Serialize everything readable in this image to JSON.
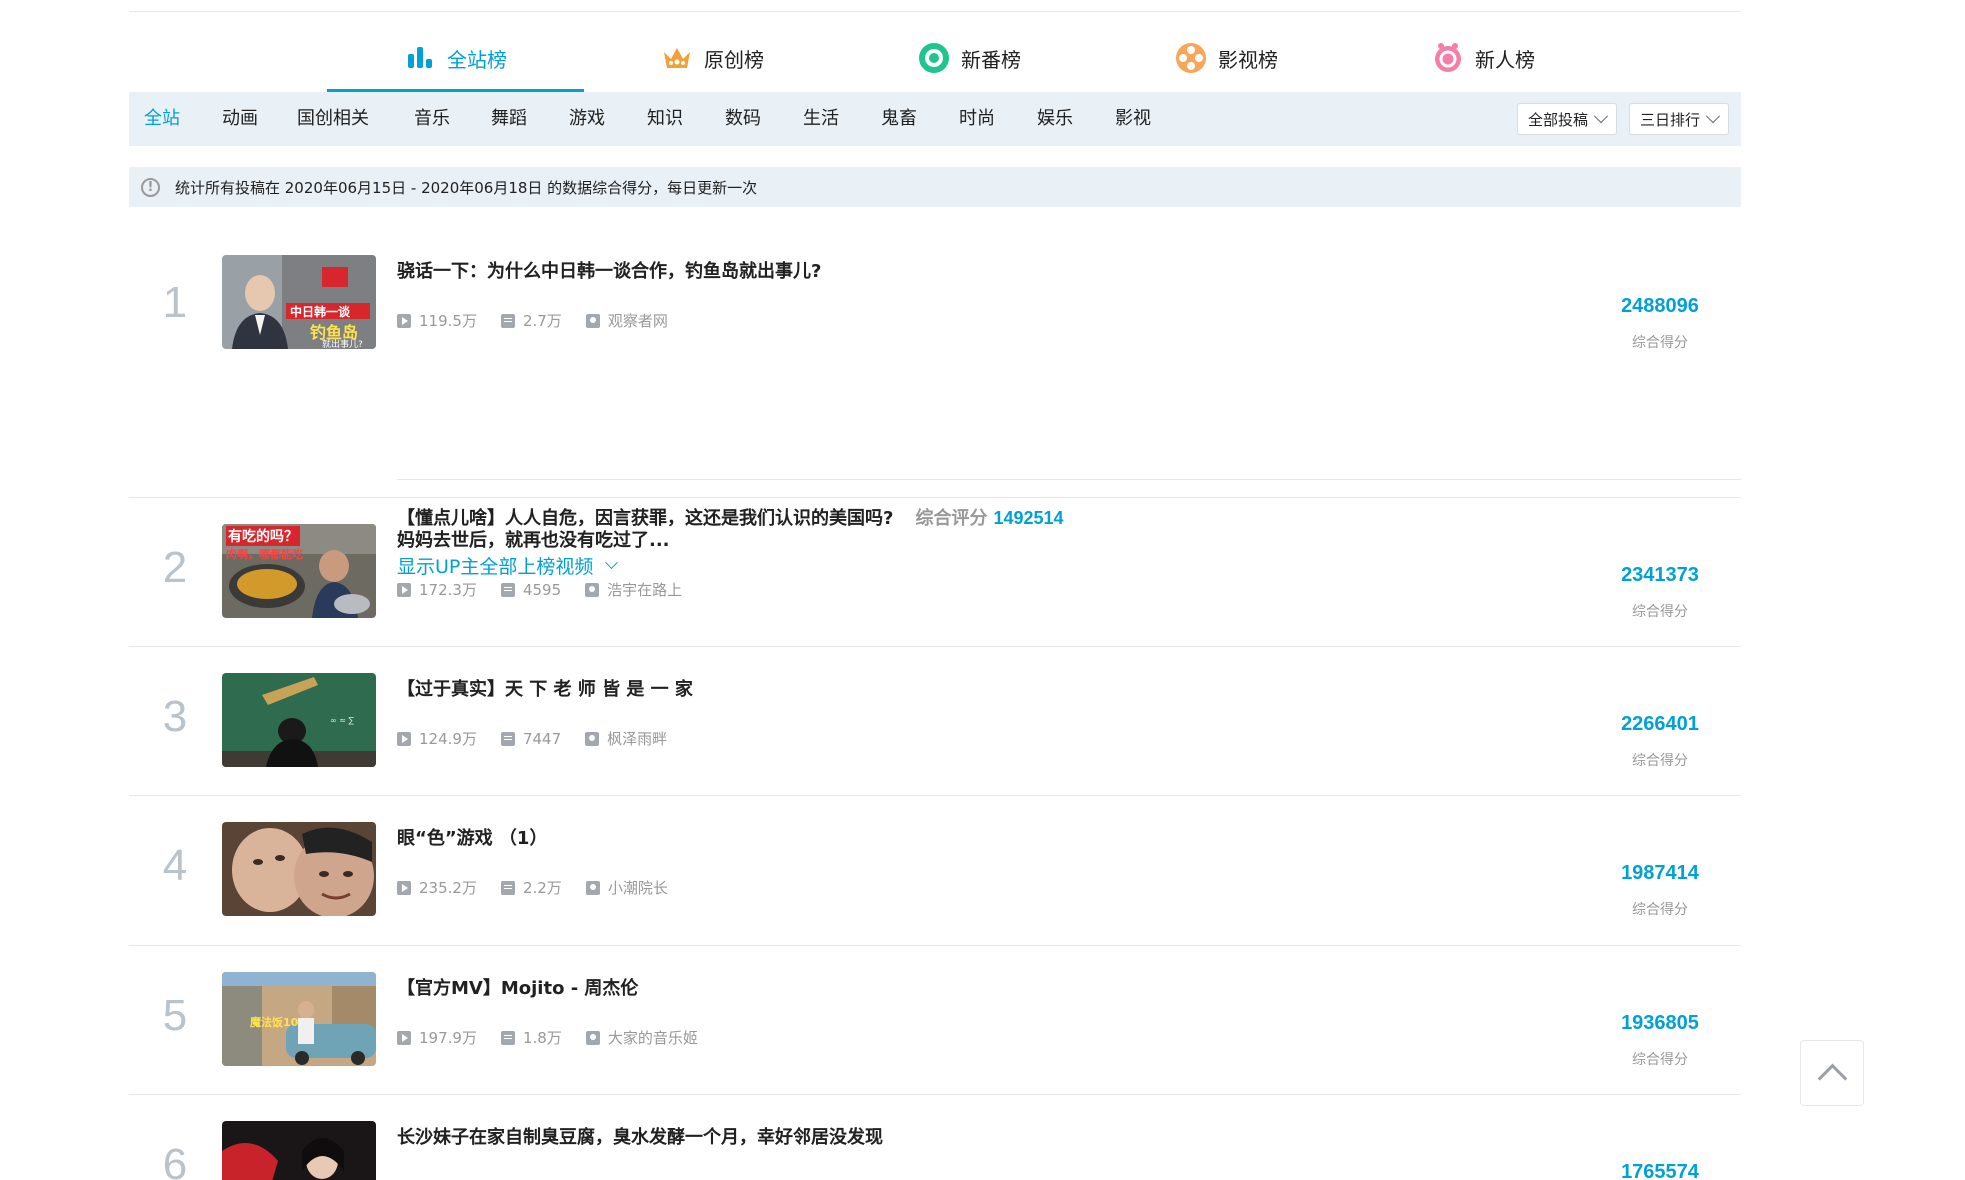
{
  "rank_tabs": [
    {
      "label": "全站榜",
      "icon": "bar-chart-icon",
      "active": true
    },
    {
      "label": "原创榜",
      "icon": "crown-icon",
      "active": false
    },
    {
      "label": "新番榜",
      "icon": "ring-icon",
      "active": false
    },
    {
      "label": "影视榜",
      "icon": "film-reel-icon",
      "active": false
    },
    {
      "label": "新人榜",
      "icon": "newcomer-icon",
      "active": false
    }
  ],
  "categories": [
    "全站",
    "动画",
    "国创相关",
    "音乐",
    "舞蹈",
    "游戏",
    "知识",
    "数码",
    "生活",
    "鬼畜",
    "时尚",
    "娱乐",
    "影视"
  ],
  "active_category": "全站",
  "dropdowns": {
    "submission": "全部投稿",
    "period": "三日排行"
  },
  "notice": "统计所有投稿在 2020年06月15日 - 2020年06月18日 的数据综合得分，每日更新一次",
  "items": [
    {
      "rank": "1",
      "title": "骁话一下：为什么中日韩一谈合作，钓鱼岛就出事儿?",
      "plays": "119.5万",
      "danmaku": "2.7万",
      "up": "观察者网",
      "score": "2488096",
      "score_label": "综合得分"
    },
    {
      "rank": "2",
      "title": "妈妈去世后，就再也没有吃过了...",
      "plays": "172.3万",
      "danmaku": "4595",
      "up": "浩宇在路上",
      "score": "2341373",
      "score_label": "综合得分"
    },
    {
      "rank": "3",
      "title": "【过于真实】天 下 老 师 皆 是 一 家",
      "plays": "124.9万",
      "danmaku": "7447",
      "up": "枫泽雨畔",
      "score": "2266401",
      "score_label": "综合得分"
    },
    {
      "rank": "4",
      "title": "眼“色”游戏 （1）",
      "plays": "235.2万",
      "danmaku": "2.2万",
      "up": "小潮院长",
      "score": "1987414",
      "score_label": "综合得分"
    },
    {
      "rank": "5",
      "title": "【官方MV】Mojito - 周杰伦",
      "plays": "197.9万",
      "danmaku": "1.8万",
      "up": "大家的音乐姬",
      "score": "1936805",
      "score_label": "综合得分"
    },
    {
      "rank": "6",
      "title": "长沙妹子在家自制臭豆腐，臭水发酵一个月，幸好邻居没发现",
      "plays": "",
      "danmaku": "",
      "up": "",
      "score": "1765574",
      "score_label": ""
    }
  ],
  "first_extra": {
    "other_title": "【懂点儿啥】人人自危，因言获罪，这还是我们认识的美国吗?",
    "other_label": "综合评分",
    "other_score": "1492514",
    "show_more": "显示UP主全部上榜视频"
  },
  "thumb1_text": {
    "line1": "中日韩一谈",
    "line2": "钓鱼岛",
    "line3": "就出事儿?"
  },
  "thumb2_text": {
    "line1": "有吃的吗？",
    "line2": "肉啊，哪都能吃"
  },
  "thumb5_text": "魔法饭10",
  "colors": {
    "accent": "#00a1d6",
    "bar_bg": "#e9f0f6",
    "rank_num": "#bac2ca"
  }
}
